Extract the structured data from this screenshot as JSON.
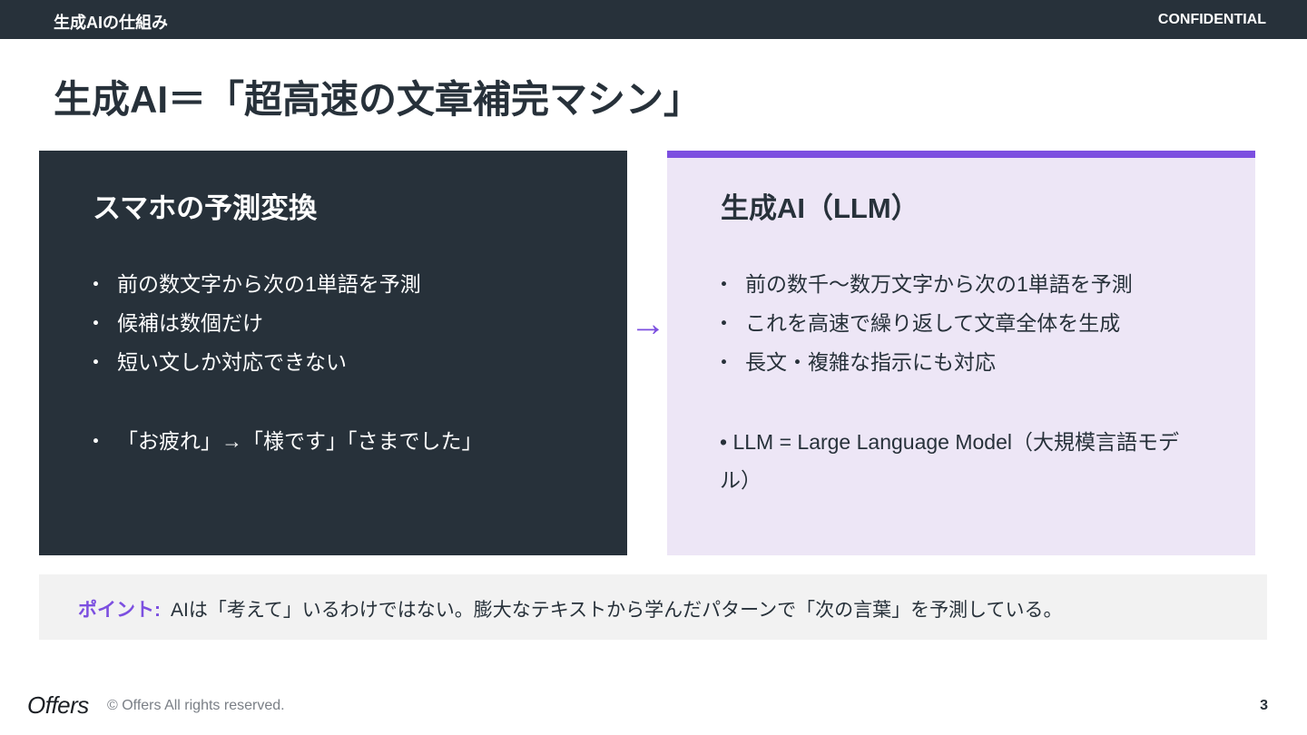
{
  "header": {
    "section_title": "生成AIの仕組み",
    "confidentiality": "CONFIDENTIAL"
  },
  "slide": {
    "title": "生成AI＝「超高速の文章補完マシン」"
  },
  "left_card": {
    "heading": "スマホの予測変換",
    "bullets": [
      "前の数文字から次の1単語を予測",
      "候補は数個だけ",
      "短い文しか対応できない",
      "「お疲れ」→「様です」「さまでした」"
    ]
  },
  "arrow": "→",
  "right_card": {
    "heading": "生成AI（LLM）",
    "bullets": [
      "前の数千〜数万文字から次の1単語を予測",
      "これを高速で繰り返して文章全体を生成",
      "長文・複雑な指示にも対応"
    ],
    "note": "• LLM = Large Language Model（大規模言語モデル）"
  },
  "point": {
    "label": "ポイント:",
    "text": "AIは「考えて」いるわけではない。膨大なテキストから学んだパターンで「次の言葉」を予測している。"
  },
  "footer": {
    "logo": "Offers",
    "copyright": "© Offers All rights reserved.",
    "page_number": "3"
  },
  "colors": {
    "dark": "#27313a",
    "accent": "#7c4fe0",
    "lavender": "#ede6f6",
    "point_bg": "#f2f2f2"
  }
}
